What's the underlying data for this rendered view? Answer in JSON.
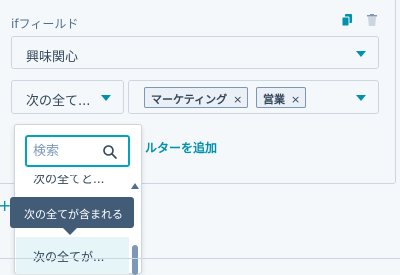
{
  "card": {
    "field_label": "ifフィールド",
    "copy_icon": "copy-icon",
    "delete_icon": "trash-icon"
  },
  "property_select": {
    "value": "興味関心"
  },
  "operator_select": {
    "value": "次の全て..."
  },
  "values_select": {
    "tags": [
      {
        "label": "マーケティング",
        "remove": "×"
      },
      {
        "label": "営業",
        "remove": "×"
      }
    ]
  },
  "add_filter_link": "ルターを追加",
  "add_icon": "+",
  "dropdown": {
    "search_placeholder": "検索",
    "partial_option": "次の全てと...",
    "selected_option": "次の全てが..."
  },
  "tooltip": "次の全てが含まれる",
  "colors": {
    "accent": "#0091ae",
    "tooltip_bg": "#425b76",
    "tag_bg": "#eaf0f6",
    "selected_bg": "#e5f5f8"
  }
}
